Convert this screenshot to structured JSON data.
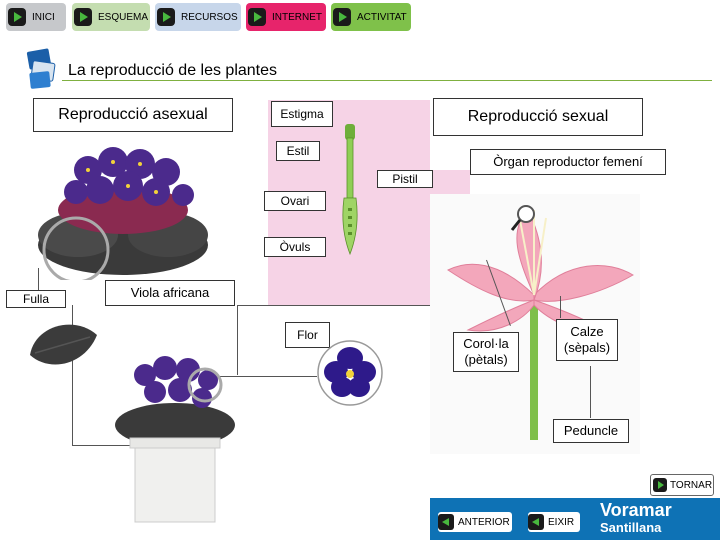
{
  "nav": {
    "items": [
      {
        "label": "INICI",
        "color": "#c6c8cb"
      },
      {
        "label": "ESQUEMA",
        "color": "#c4ddb0"
      },
      {
        "label": "RECURSOS",
        "color": "#c7d6ea"
      },
      {
        "label": "INTERNET",
        "color": "#e7246b"
      },
      {
        "label": "ACTIVITAT",
        "color": "#7fc14a"
      }
    ]
  },
  "page": {
    "title": "La reproducció de les plantes"
  },
  "sections": {
    "asexual": "Reproducció asexual",
    "sexual": "Reproducció sexual"
  },
  "labels": {
    "estigma": "Estigma",
    "estil": "Estil",
    "organ": "Òrgan reproductor femení",
    "pistil": "Pistil",
    "ovari": "Ovari",
    "ovuls": "Òvuls",
    "fulla": "Fulla",
    "viola": "Viola africana",
    "flor": "Flor",
    "corola_line1": "Corol·la",
    "corola_line2": "(pètals)",
    "calze_line1": "Calze",
    "calze_line2": "(sèpals)",
    "peduncle": "Peduncle"
  },
  "footer": {
    "tornar": "TORNAR",
    "anterior": "ANTERIOR",
    "eixir": "EIXIR",
    "brand_line1": "Voramar",
    "brand_line2": "Santillana"
  },
  "colors": {
    "accent_green": "#48b83e",
    "pink_zone": "#f6d3e6",
    "violet": "#4b2a8c",
    "leaf": "#3b3b3b",
    "lily_pink": "#f3a7bb",
    "stem": "#7fbf4a"
  }
}
